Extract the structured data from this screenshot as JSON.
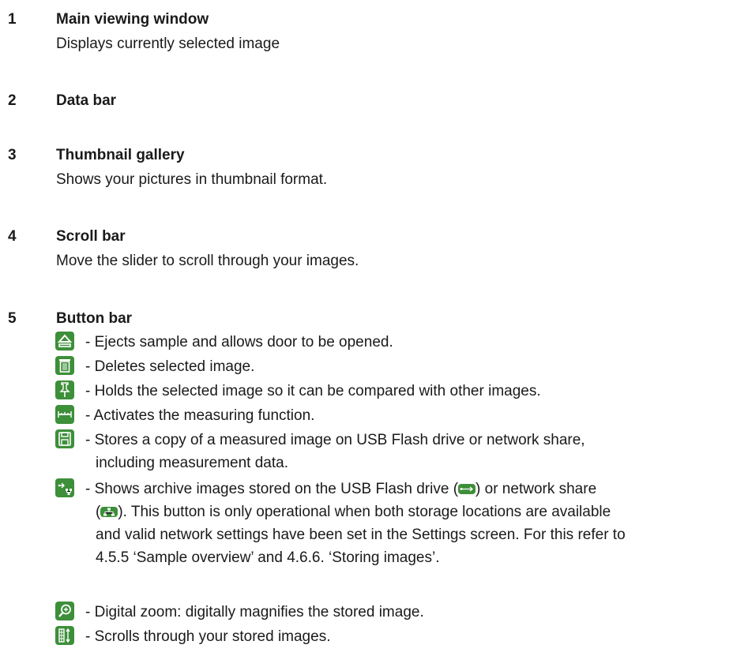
{
  "sections": [
    {
      "number": "1",
      "title": "Main viewing window",
      "description": "Displays currently selected image"
    },
    {
      "number": "2",
      "title": "Data bar",
      "description": ""
    },
    {
      "number": "3",
      "title": "Thumbnail gallery",
      "description": "Shows your pictures in thumbnail format."
    },
    {
      "number": "4",
      "title": "Scroll bar",
      "description": "Move the slider to scroll through your images."
    },
    {
      "number": "5",
      "title": "Button bar",
      "description": ""
    }
  ],
  "buttons": [
    {
      "icon": "eject-icon",
      "text": "- Ejects sample and allows door to be opened."
    },
    {
      "icon": "trash-icon",
      "text": "- Deletes selected image."
    },
    {
      "icon": "pin-icon",
      "text": "- Holds the selected image so it can be compared with other images."
    },
    {
      "icon": "ruler-icon",
      "text": "- Activates the measuring function."
    },
    {
      "icon": "save-icon",
      "text_lines": [
        "- Stores a copy of a measured image on USB Flash drive or network share,",
        "including measurement data."
      ]
    },
    {
      "icon": "archive-icon",
      "text_parts": {
        "a": "- Shows archive images stored on the USB Flash drive (",
        "b": ") or network share",
        "c": "(",
        "d": "). This button is only operational when both storage locations are available",
        "e": "and valid network settings have been set in the Settings screen. For this refer to",
        "f": "4.5.5 ‘Sample overview’ and 4.6.6. ‘Storing images’."
      }
    },
    {
      "icon": "zoom-icon",
      "text": "- Digital zoom: digitally magnifies the stored image."
    },
    {
      "icon": "scroll-icon",
      "text": "- Scrolls through your stored images."
    }
  ],
  "colors": {
    "icon_green": "#3d8f3a",
    "text": "#1a1a1a"
  }
}
